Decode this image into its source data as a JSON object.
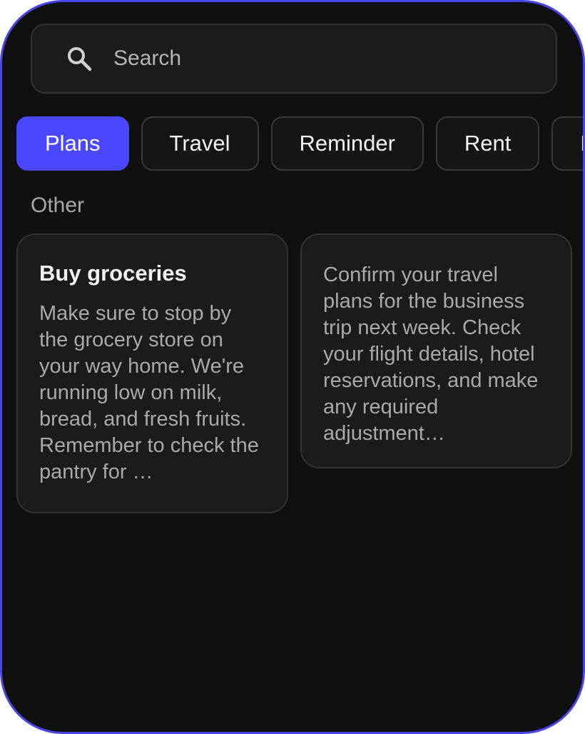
{
  "search": {
    "placeholder": "Search",
    "icon": "search-icon"
  },
  "chips": [
    {
      "label": "Plans",
      "active": true
    },
    {
      "label": "Travel",
      "active": false
    },
    {
      "label": "Reminder",
      "active": false
    },
    {
      "label": "Rent",
      "active": false
    },
    {
      "label": "M",
      "active": false
    }
  ],
  "section": {
    "label": "Other"
  },
  "notes": [
    {
      "title": "Buy groceries",
      "body": "Make sure to stop by the grocery store on your way home. We're running low on milk, bread, and fresh fruits. Remember to check the pantry for …"
    },
    {
      "title": "",
      "body": "Confirm your travel plans for the business trip next week. Check your flight details, hotel reservations, and make any required adjustment…"
    }
  ],
  "colors": {
    "accent": "#4a47ff",
    "frame": "#4a45e8",
    "background": "#101010",
    "card": "#1b1b1b"
  }
}
